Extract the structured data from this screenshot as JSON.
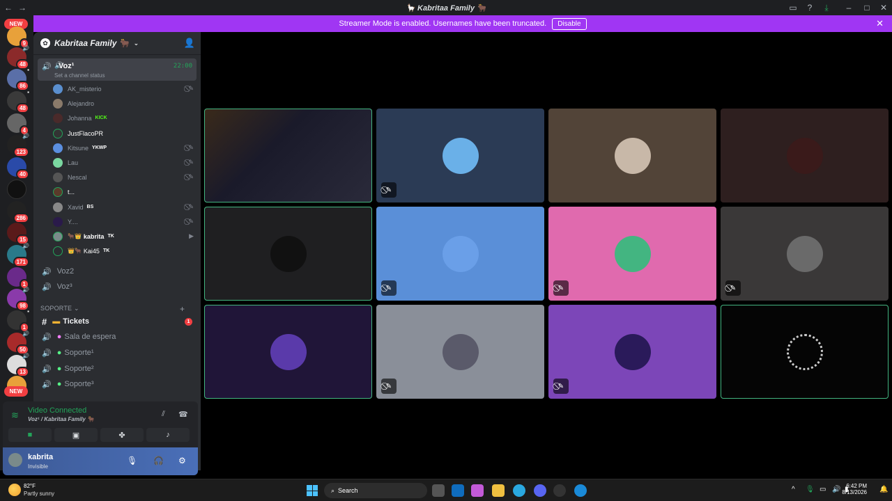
{
  "window": {
    "title": "🦙 Kabritaa Family 🐂"
  },
  "banner": {
    "text": "Streamer Mode is enabled. Usernames have been truncated.",
    "button": "Disable"
  },
  "server_rail": {
    "new_top": "NEW",
    "new_bottom": "NEW",
    "badges": [
      "9",
      "48",
      "86",
      "48",
      "4",
      "123",
      "40",
      "286",
      "15",
      "171",
      "1",
      "98",
      "1",
      "50",
      "13"
    ]
  },
  "server": {
    "name": "Kabritaa Family 🐂"
  },
  "channel": {
    "selected_name": "Voz¹",
    "status_hint": "Set a channel status",
    "timer": "22:00",
    "voz2": "Voz2",
    "voz3": "Voz³"
  },
  "members": [
    {
      "name": "AK_misterio",
      "tag": ""
    },
    {
      "name": "Alejandro",
      "tag": ""
    },
    {
      "name": "Johanna",
      "tag": "KICK"
    },
    {
      "name": "JustFlacoPR",
      "tag": ""
    },
    {
      "name": "Kitsune",
      "tag": "YKWP"
    },
    {
      "name": "Lau",
      "tag": ""
    },
    {
      "name": "Nescal",
      "tag": ""
    },
    {
      "name": "t...",
      "tag": ""
    },
    {
      "name": "Xavid",
      "tag": "BS"
    },
    {
      "name": "Y....",
      "tag": ""
    },
    {
      "name": "kabrita",
      "tag": "TK"
    },
    {
      "name": "Kai45",
      "tag": "TK"
    }
  ],
  "support": {
    "category": "SOPORTE",
    "tickets": "Tickets",
    "tickets_badge": "1",
    "waiting": "Sala de espera",
    "s1": "Soporte¹",
    "s2": "Soporte²",
    "s3": "Soporte³"
  },
  "voice_panel": {
    "status": "Video Connected",
    "location": "Voz¹ / Kabritaa Family 🐂"
  },
  "user_panel": {
    "name": "kabrita",
    "status": "Invisible"
  },
  "taskbar": {
    "temp": "82°F",
    "condition": "Partly sunny",
    "search": "Search",
    "time": "6:42 PM",
    "date": "8/13/2026"
  },
  "accent": "#a036f3"
}
